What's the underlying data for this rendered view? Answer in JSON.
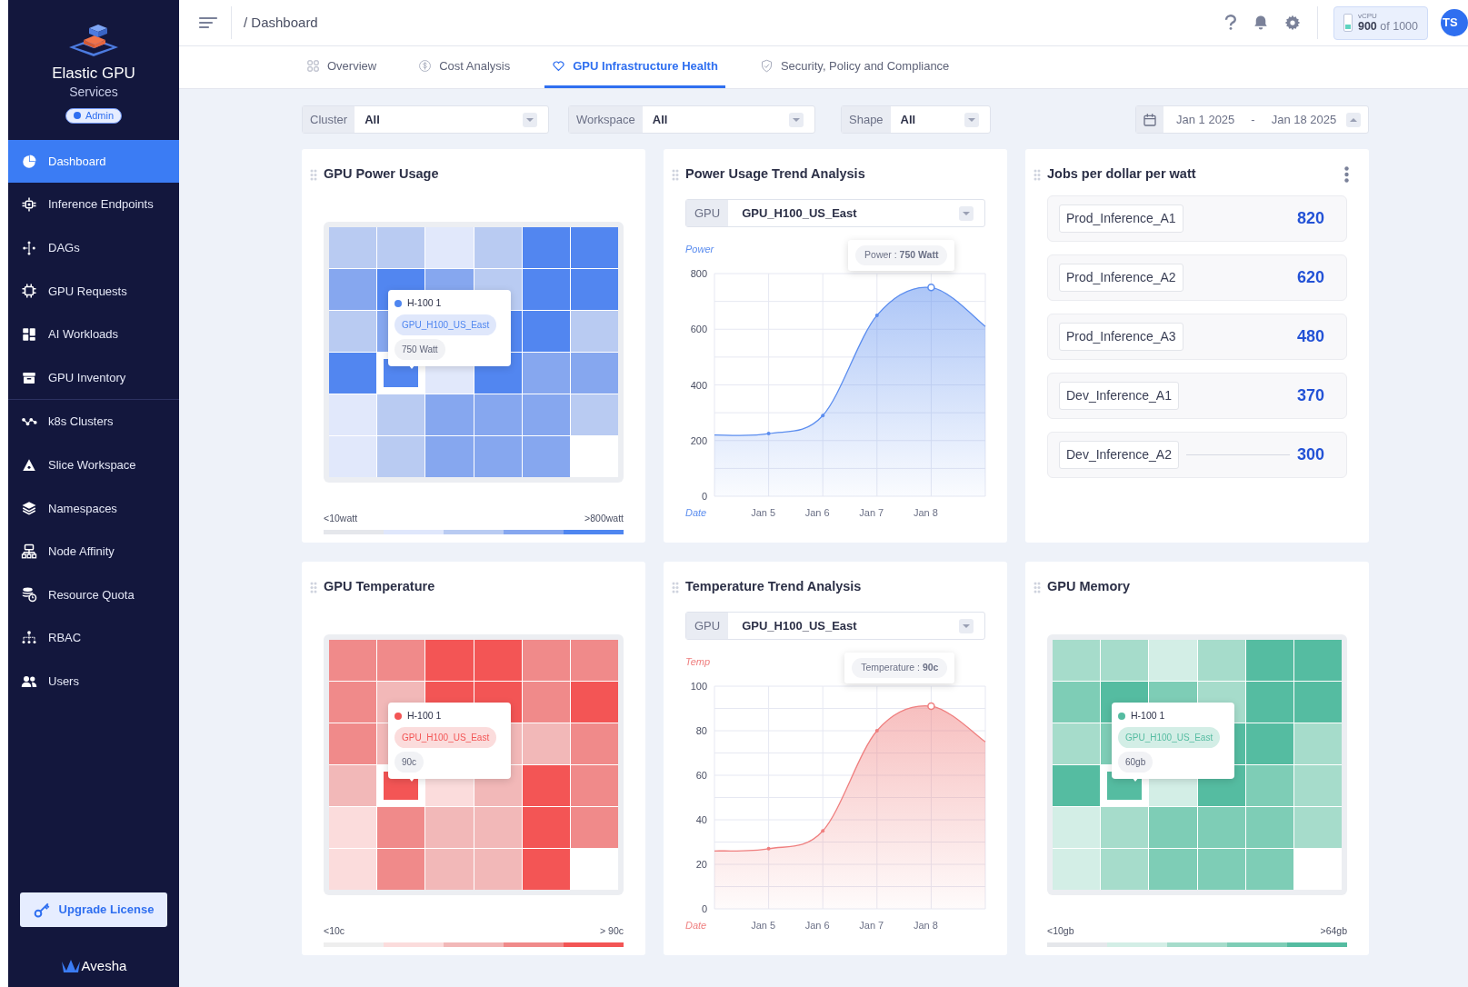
{
  "sidebar": {
    "brand_title": "Elastic GPU",
    "brand_subtitle": "Services",
    "role_badge": "Admin",
    "item_groups": [
      [
        {
          "label": "Dashboard",
          "selected": true
        },
        {
          "label": "Inference Endpoints",
          "selected": false
        },
        {
          "label": "DAGs",
          "selected": false
        },
        {
          "label": "GPU Requests",
          "selected": false
        },
        {
          "label": "AI Workloads",
          "selected": false
        },
        {
          "label": "GPU Inventory",
          "selected": false
        }
      ],
      [
        {
          "label": "k8s Clusters",
          "selected": false
        },
        {
          "label": "Slice Workspace",
          "selected": false
        },
        {
          "label": "Namespaces",
          "selected": false
        },
        {
          "label": "Node Affinity",
          "selected": false
        },
        {
          "label": "Resource Quota",
          "selected": false
        },
        {
          "label": "RBAC",
          "selected": false
        },
        {
          "label": "Users",
          "selected": false
        }
      ]
    ],
    "upgrade_button": "Upgrade License",
    "footer_logo": "Avesha"
  },
  "header": {
    "breadcrumb": "/ Dashboard",
    "vcpu": {
      "label": "vCPU",
      "usage": "**900** of 1000"
    },
    "avatar": "TS"
  },
  "tabs": [
    {
      "label": "Overview",
      "selected": false
    },
    {
      "label": "Cost Analysis",
      "selected": false
    },
    {
      "label": "GPU Infrastructure Health",
      "selected": true
    },
    {
      "label": "Security, Policy and Compliance",
      "selected": false
    }
  ],
  "filters": [
    {
      "label": "Cluster",
      "value": "All"
    },
    {
      "label": "Workspace",
      "value": "All"
    },
    {
      "label": "Shape",
      "value": "All"
    }
  ],
  "date_range": {
    "start": "Jan 1 2025",
    "separator": "-",
    "end": "Jan 18 2025"
  },
  "cards": [
    {
      "kind": "heatmap",
      "title": "GPU Power Usage",
      "tooltip": {
        "node": "H-100 1",
        "gpu": "GPU_H100_US_East",
        "value": "750 Watt"
      },
      "cells": [
        [
          {
            "color": "#b9cbf2",
            "selected": false
          },
          {
            "color": "#b9cbf2",
            "selected": false
          },
          {
            "color": "#e1e8fb",
            "selected": false
          },
          {
            "color": "#b9cbf2",
            "selected": false
          },
          {
            "color": "#5286f0",
            "selected": false
          },
          {
            "color": "#5286f0",
            "selected": false
          }
        ],
        [
          {
            "color": "#86a7ef",
            "selected": false
          },
          {
            "color": "#5286f0",
            "selected": false
          },
          {
            "color": "#86a7ef",
            "selected": false
          },
          {
            "color": "#b9cbf2",
            "selected": false
          },
          {
            "color": "#5286f0",
            "selected": false
          },
          {
            "color": "#5286f0",
            "selected": false
          }
        ],
        [
          {
            "color": "#b9cbf2",
            "selected": false
          },
          {
            "color": "#86a7ef",
            "selected": false
          },
          null,
          {
            "color": "#5286f0",
            "selected": false
          },
          {
            "color": "#5286f0",
            "selected": false
          },
          {
            "color": "#b9cbf2",
            "selected": false
          }
        ],
        [
          {
            "color": "#5286f0",
            "selected": false
          },
          {
            "color": "#5286f0",
            "selected": true
          },
          {
            "color": "#e1e8fb",
            "selected": false
          },
          {
            "color": "#5286f0",
            "selected": false
          },
          {
            "color": "#86a7ef",
            "selected": false
          },
          {
            "color": "#86a7ef",
            "selected": false
          }
        ],
        [
          {
            "color": "#e1e8fb",
            "selected": false
          },
          {
            "color": "#b9cbf2",
            "selected": false
          },
          {
            "color": "#86a7ef",
            "selected": false
          },
          {
            "color": "#86a7ef",
            "selected": false
          },
          {
            "color": "#86a7ef",
            "selected": false
          },
          {
            "color": "#b9cbf2",
            "selected": false
          }
        ],
        [
          {
            "color": "#e1e8fb",
            "selected": false
          },
          {
            "color": "#b9cbf2",
            "selected": false
          },
          {
            "color": "#86a7ef",
            "selected": false
          },
          {
            "color": "#86a7ef",
            "selected": false
          },
          {
            "color": "#86a7ef",
            "selected": false
          },
          null
        ]
      ],
      "legend": {
        "low": "<10watt",
        "high": ">800watt",
        "scale": [
          {
            "color": "#e5e7eb"
          },
          {
            "color": "#dfe7fb"
          },
          {
            "color": "#b9cbf2"
          },
          {
            "color": "#86a7ef"
          },
          {
            "color": "#4f86f0"
          }
        ]
      }
    },
    {
      "kind": "trend",
      "title": "Power Usage Trend Analysis",
      "select": {
        "label": "GPU",
        "value": "GPU_H100_US_East"
      },
      "tooltip": "Power : **750 Watt**",
      "chart_data": {
        "type": "area",
        "xlabel": "Date",
        "ylabel": "Power",
        "categories": [
          null,
          "Jan 5",
          "Jan 6",
          "Jan 7",
          "Jan 8",
          null
        ],
        "series": [
          {
            "color": "#5b8def",
            "values": [
              220,
              225,
              290,
              650,
              750,
              610
            ]
          }
        ],
        "ylim": [
          0,
          800
        ],
        "yticks": [
          0,
          200,
          400,
          600,
          800
        ],
        "grid": true
      }
    },
    {
      "kind": "ranking",
      "title": "Jobs per dollar per watt",
      "rows": [
        {
          "name": "Prod_Inference_A1",
          "value": "820",
          "hovered": false
        },
        {
          "name": "Prod_Inference_A2",
          "value": "620",
          "hovered": false
        },
        {
          "name": "Prod_Inference_A3",
          "value": "480",
          "hovered": false
        },
        {
          "name": "Dev_Inference_A1",
          "value": "370",
          "hovered": false
        },
        {
          "name": "Dev_Inference_A2",
          "value": "300",
          "hovered": true
        }
      ]
    },
    {
      "kind": "heatmap",
      "title": "GPU Temperature",
      "tooltip": {
        "node": "H-100 1",
        "gpu": "GPU_H100_US_East",
        "value": "90c"
      },
      "cells": [
        [
          {
            "color": "#f08a8a",
            "selected": false
          },
          {
            "color": "#f08a8a",
            "selected": false
          },
          {
            "color": "#f35555",
            "selected": false
          },
          {
            "color": "#f35555",
            "selected": false
          },
          {
            "color": "#f08a8a",
            "selected": false
          },
          {
            "color": "#f08a8a",
            "selected": false
          }
        ],
        [
          {
            "color": "#f08a8a",
            "selected": false
          },
          {
            "color": "#f2b8b8",
            "selected": false
          },
          {
            "color": "#f35555",
            "selected": false
          },
          {
            "color": "#f35555",
            "selected": false
          },
          {
            "color": "#f08a8a",
            "selected": false
          },
          {
            "color": "#f35555",
            "selected": false
          }
        ],
        [
          {
            "color": "#f08a8a",
            "selected": false
          },
          {
            "color": "#f2b8b8",
            "selected": false
          },
          null,
          {
            "color": "#f2b8b8",
            "selected": false
          },
          {
            "color": "#f2b8b8",
            "selected": false
          },
          {
            "color": "#f08a8a",
            "selected": false
          }
        ],
        [
          {
            "color": "#f2b8b8",
            "selected": false
          },
          {
            "color": "#f35555",
            "selected": true
          },
          {
            "color": "#fbdcdc",
            "selected": false
          },
          {
            "color": "#f2b8b8",
            "selected": false
          },
          {
            "color": "#f35555",
            "selected": false
          },
          {
            "color": "#f08a8a",
            "selected": false
          }
        ],
        [
          {
            "color": "#fbdcdc",
            "selected": false
          },
          {
            "color": "#f08a8a",
            "selected": false
          },
          {
            "color": "#f2b8b8",
            "selected": false
          },
          {
            "color": "#f2b8b8",
            "selected": false
          },
          {
            "color": "#f35555",
            "selected": false
          },
          {
            "color": "#f08a8a",
            "selected": false
          }
        ],
        [
          {
            "color": "#fbdcdc",
            "selected": false
          },
          {
            "color": "#f08a8a",
            "selected": false
          },
          {
            "color": "#f2b8b8",
            "selected": false
          },
          {
            "color": "#f2b8b8",
            "selected": false
          },
          {
            "color": "#f35555",
            "selected": false
          },
          null
        ]
      ],
      "legend": {
        "low": "<10c",
        "high": "> 90c",
        "scale": [
          {
            "color": "#eeeeee"
          },
          {
            "color": "#fbdcdc"
          },
          {
            "color": "#f2b8b8"
          },
          {
            "color": "#f08a8a"
          },
          {
            "color": "#f35555"
          }
        ]
      }
    },
    {
      "kind": "trend",
      "title": "Temperature Trend Analysis",
      "select": {
        "label": "GPU",
        "value": "GPU_H100_US_East"
      },
      "tooltip": "Temperature : **90c**",
      "chart_data": {
        "type": "area",
        "xlabel": "Date",
        "ylabel": "Temp",
        "categories": [
          null,
          "Jan 5",
          "Jan 6",
          "Jan 7",
          "Jan 8",
          null
        ],
        "series": [
          {
            "color": "#ef7f7f",
            "values": [
              26,
              27,
              35,
              80,
              91,
              75
            ]
          }
        ],
        "ylim": [
          0,
          100
        ],
        "yticks": [
          0,
          20,
          40,
          60,
          80,
          100
        ],
        "grid": true
      }
    },
    {
      "kind": "heatmap",
      "title": "GPU Memory",
      "tooltip": {
        "node": "H-100 1",
        "gpu": "GPU_H100_US_East",
        "value": "60gb"
      },
      "cells": [
        [
          {
            "color": "#a6dccb",
            "selected": false
          },
          {
            "color": "#a6dccb",
            "selected": false
          },
          {
            "color": "#d3eee6",
            "selected": false
          },
          {
            "color": "#a6dccb",
            "selected": false
          },
          {
            "color": "#55bca1",
            "selected": false
          },
          {
            "color": "#55bca1",
            "selected": false
          }
        ],
        [
          {
            "color": "#7ecdb6",
            "selected": false
          },
          {
            "color": "#55bca1",
            "selected": false
          },
          {
            "color": "#7ecdb6",
            "selected": false
          },
          {
            "color": "#a6dccb",
            "selected": false
          },
          {
            "color": "#55bca1",
            "selected": false
          },
          {
            "color": "#55bca1",
            "selected": false
          }
        ],
        [
          {
            "color": "#a6dccb",
            "selected": false
          },
          {
            "color": "#7ecdb6",
            "selected": false
          },
          null,
          {
            "color": "#55bca1",
            "selected": false
          },
          {
            "color": "#55bca1",
            "selected": false
          },
          {
            "color": "#a6dccb",
            "selected": false
          }
        ],
        [
          {
            "color": "#55bca1",
            "selected": false
          },
          {
            "color": "#55bca1",
            "selected": true
          },
          {
            "color": "#d3eee6",
            "selected": false
          },
          {
            "color": "#55bca1",
            "selected": false
          },
          {
            "color": "#7ecdb6",
            "selected": false
          },
          {
            "color": "#a6dccb",
            "selected": false
          }
        ],
        [
          {
            "color": "#d3eee6",
            "selected": false
          },
          {
            "color": "#a6dccb",
            "selected": false
          },
          {
            "color": "#7ecdb6",
            "selected": false
          },
          {
            "color": "#7ecdb6",
            "selected": false
          },
          {
            "color": "#7ecdb6",
            "selected": false
          },
          {
            "color": "#a6dccb",
            "selected": false
          }
        ],
        [
          {
            "color": "#d3eee6",
            "selected": false
          },
          {
            "color": "#a6dccb",
            "selected": false
          },
          {
            "color": "#7ecdb6",
            "selected": false
          },
          {
            "color": "#7ecdb6",
            "selected": false
          },
          {
            "color": "#7ecdb6",
            "selected": false
          },
          null
        ]
      ],
      "legend": {
        "low": "<10gb",
        "high": ">64gb",
        "scale": [
          {
            "color": "#e5e7eb"
          },
          {
            "color": "#d3eee6"
          },
          {
            "color": "#a6dccb"
          },
          {
            "color": "#7ecdb6"
          },
          {
            "color": "#55bca1"
          }
        ]
      }
    }
  ]
}
